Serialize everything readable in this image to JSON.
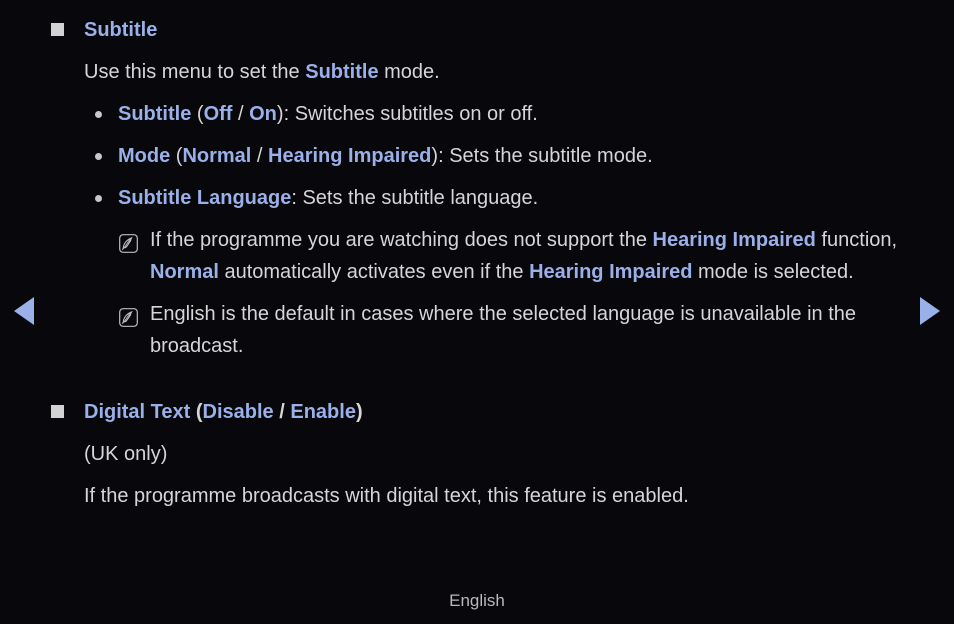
{
  "page": {
    "background_color": "#07070c",
    "accent_color": "#9ab0e8",
    "body_text_color": "#d6d6d6"
  },
  "nav": {
    "prev_label": "◀",
    "prev_name": "previous-page-arrow",
    "next_label": "▶",
    "next_name": "next-page-arrow"
  },
  "sections": [
    {
      "title": "Subtitle",
      "intro": {
        "pre": "Use this menu to set the ",
        "term": "Subtitle",
        "post": " mode."
      },
      "bullets": [
        {
          "term": "Subtitle",
          "open_paren": " (",
          "opt1": "Off",
          "sep": " / ",
          "opt2": "On",
          "close_paren": ")",
          "desc": ": Switches subtitles on or off."
        },
        {
          "term": "Mode",
          "open_paren": " (",
          "opt1": "Normal",
          "sep": " / ",
          "opt2": "Hearing Impaired",
          "close_paren": ")",
          "desc": ": Sets the subtitle mode."
        },
        {
          "term": "Subtitle Language",
          "open_paren": "",
          "opt1": "",
          "sep": "",
          "opt2": "",
          "close_paren": "",
          "desc": ": Sets the subtitle language."
        }
      ],
      "notes": [
        {
          "t1": "If the programme you are watching does not support the ",
          "b1": "Hearing Impaired",
          "t2": " function, ",
          "b2": "Normal",
          "t3": " automatically activates even if the ",
          "b3": "Hearing Impaired",
          "t4": " mode is selected."
        },
        {
          "t1": "English is the default in cases where the selected language is unavailable in the broadcast.",
          "b1": "",
          "t2": "",
          "b2": "",
          "t3": "",
          "b3": "",
          "t4": ""
        }
      ]
    },
    {
      "title_term": "Digital Text",
      "title_open_paren": " (",
      "title_opt1": "Disable",
      "title_sep": " / ",
      "title_opt2": "Enable",
      "title_close_paren": ")",
      "para1": "(UK only)",
      "para2": "If the programme broadcasts with digital text, this feature is enabled."
    }
  ],
  "footer": {
    "language": "English"
  }
}
